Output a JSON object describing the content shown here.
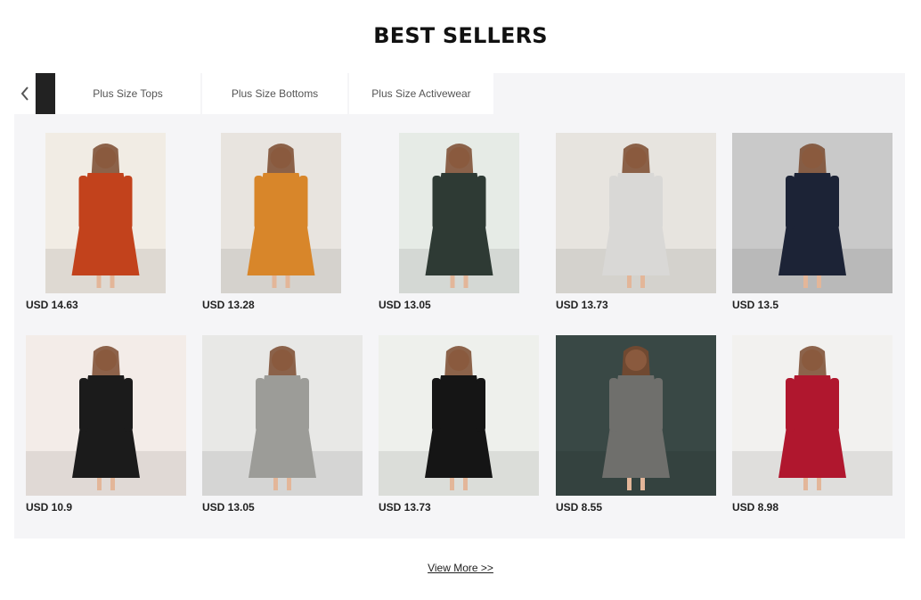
{
  "section": {
    "title": "BEST SELLERS",
    "view_more": "View More >>"
  },
  "tabs": [
    {
      "label": "Plus Size Tops"
    },
    {
      "label": "Plus Size Bottoms"
    },
    {
      "label": "Plus Size Activewear"
    }
  ],
  "products": [
    {
      "price": "USD 14.63",
      "image": "rust-red-maxi-dress",
      "color": "#c2421c",
      "bg": "#f1ece4"
    },
    {
      "price": "USD 13.28",
      "image": "orange-teal-print-kaftan",
      "color": "#d8862a",
      "bg": "#e8e4df"
    },
    {
      "price": "USD 13.05",
      "image": "green-leaf-print-kaftan",
      "color": "#2e3a34",
      "bg": "#e6ebe6"
    },
    {
      "price": "USD 13.73",
      "image": "white-printed-midi-dress",
      "color": "#d9d8d6",
      "bg": "#e7e4df"
    },
    {
      "price": "USD 13.5",
      "image": "navy-plaid-panel-dress",
      "color": "#1c2336",
      "bg": "#c9c9c9"
    },
    {
      "price": "USD 10.9",
      "image": "black-floral-wrap-dress",
      "color": "#1b1b1b",
      "bg": "#f3ece8"
    },
    {
      "price": "USD 13.05",
      "image": "grey-printed-wrap-dress",
      "color": "#9c9c98",
      "bg": "#e8e8e6"
    },
    {
      "price": "USD 13.73",
      "image": "black-maxi-dress-print-sleeves",
      "color": "#151515",
      "bg": "#eef0ec"
    },
    {
      "price": "USD 8.55",
      "image": "grey-leopard-midi-dress",
      "color": "#6f6f6c",
      "bg": "#394845"
    },
    {
      "price": "USD 8.98",
      "image": "red-belted-mini-dress",
      "color": "#b0172e",
      "bg": "#f2f1ef"
    }
  ]
}
